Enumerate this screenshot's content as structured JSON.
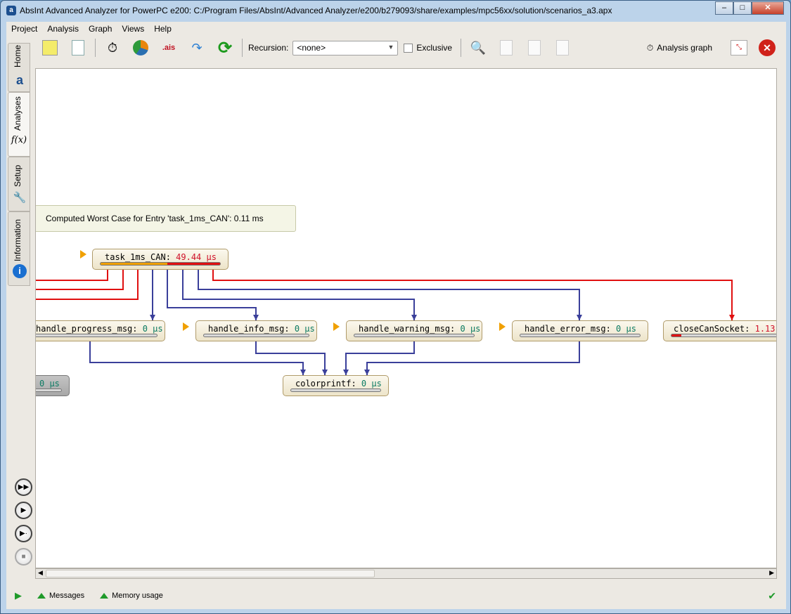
{
  "window": {
    "title": "AbsInt Advanced Analyzer for PowerPC e200: C:/Program Files/AbsInt/Advanced Analyzer/e200/b279093/share/examples/mpc56xx/solution/scenarios_a3.apx"
  },
  "menu": [
    "Project",
    "Analysis",
    "Graph",
    "Views",
    "Help"
  ],
  "toolbar": {
    "recursion_label": "Recursion:",
    "recursion_value": "<none>",
    "exclusive_label": "Exclusive",
    "exclusive_checked": false,
    "analysis_graph_label": "Analysis graph"
  },
  "sidebar": {
    "tabs": [
      {
        "label": "Home"
      },
      {
        "label": "Analyses",
        "active": true,
        "icon_text": "f(x)"
      },
      {
        "label": "Setup"
      },
      {
        "label": "Information"
      }
    ]
  },
  "graph": {
    "info": "Computed Worst Case for Entry 'task_1ms_CAN': 0.11 ms",
    "nodes": [
      {
        "name": "task_1ms_CAN",
        "label": "task_1ms_CAN: ",
        "value": "49.44 µs"
      },
      {
        "name": "handle_progress_msg",
        "label": "handle_progress_msg: ",
        "value": "0 µs"
      },
      {
        "name": "handle_info_msg",
        "label": "handle_info_msg: ",
        "value": "0 µs"
      },
      {
        "name": "handle_warning_msg",
        "label": "handle_warning_msg: ",
        "value": "0 µs"
      },
      {
        "name": "handle_error_msg",
        "label": "handle_error_msg: ",
        "value": "0 µs"
      },
      {
        "name": "closeCanSocket",
        "label": "closeCanSocket: ",
        "value": "1.13"
      },
      {
        "name": "colorprintf",
        "label": "colorprintf: ",
        "value": "0 µs"
      },
      {
        "name": "",
        "label": "",
        "value": "0 µs"
      }
    ],
    "colors": {
      "critical_edge": "#e01010",
      "edge": "#3a3f9a",
      "entry_marker": "#f0a000"
    }
  },
  "status": {
    "messages": "Messages",
    "memory": "Memory usage"
  }
}
